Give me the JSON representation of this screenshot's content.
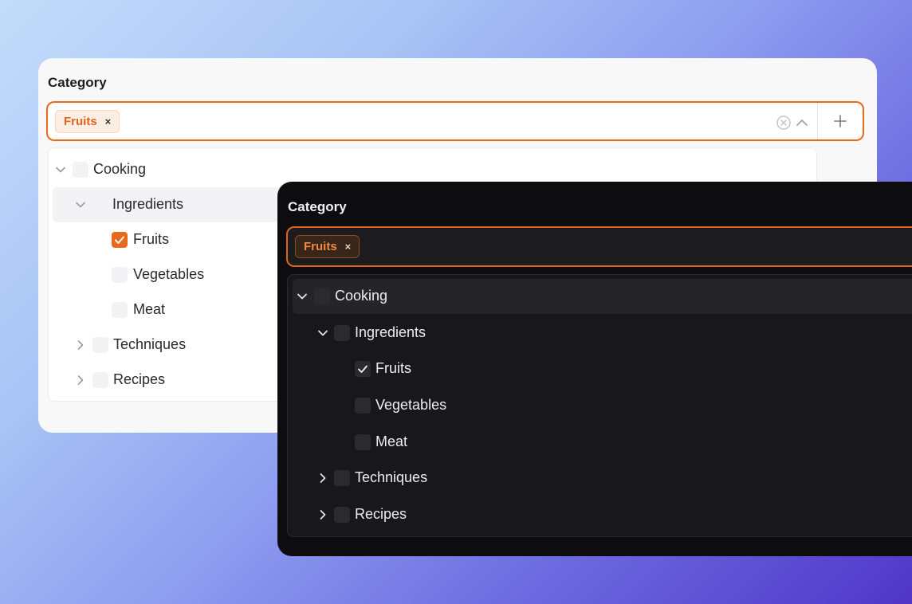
{
  "light_panel": {
    "label": "Category",
    "chip_label": "Fruits",
    "chip_remove": "×",
    "tree": {
      "cooking": "Cooking",
      "ingredients": "Ingredients",
      "fruits": "Fruits",
      "vegetables": "Vegetables",
      "meat": "Meat",
      "techniques": "Techniques",
      "recipes": "Recipes"
    },
    "checked": "Fruits"
  },
  "dark_panel": {
    "label": "Category",
    "chip_label": "Fruits",
    "chip_remove": "×",
    "tree": {
      "cooking": "Cooking",
      "ingredients": "Ingredients",
      "fruits": "Fruits",
      "vegetables": "Vegetables",
      "meat": "Meat",
      "techniques": "Techniques",
      "recipes": "Recipes"
    },
    "checked": "Fruits"
  },
  "colors": {
    "accent": "#e8681e",
    "light_bg": "#f8f8f9",
    "dark_bg": "#0d0d0f"
  },
  "icons": [
    "clear-circle-icon",
    "chevron-up-icon",
    "plus-icon",
    "chevron-down-icon",
    "chevron-right-icon",
    "check-icon",
    "close-icon"
  ]
}
